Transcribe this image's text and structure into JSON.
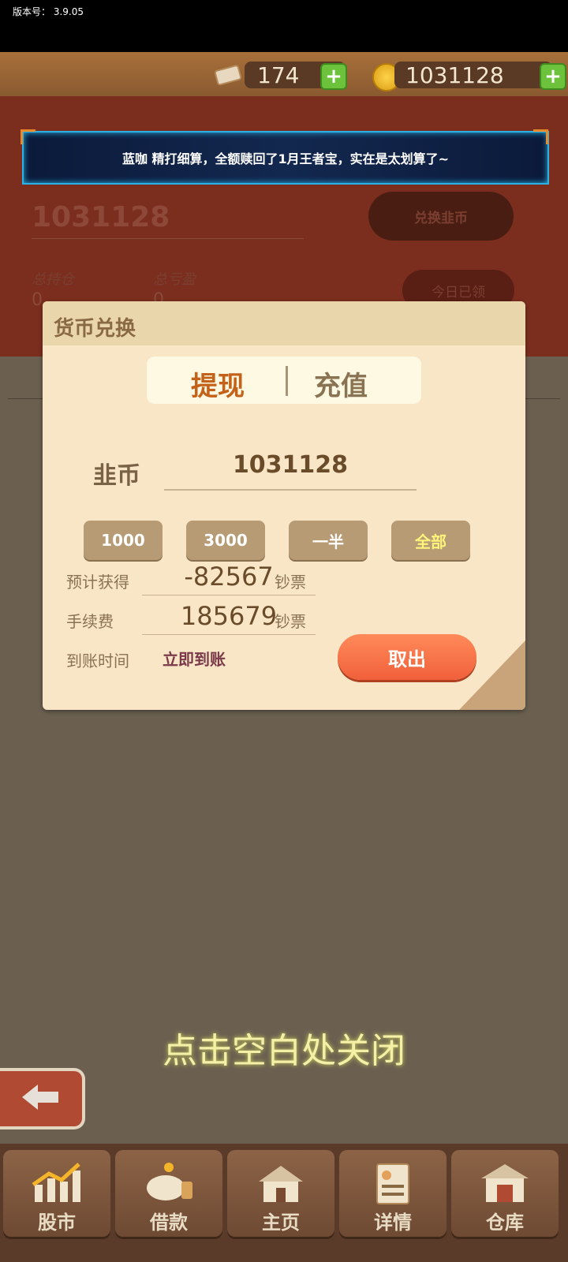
{
  "status": {
    "version_label": "版本号：",
    "version": "3.9.05"
  },
  "resources": {
    "tickets": "174",
    "coins": "1031128"
  },
  "banner": {
    "text": "蓝咖 精打细算，全额赎回了1月王者宝，实在是太划算了~"
  },
  "background": {
    "balance": "1031128",
    "exchange_button": "兑换韭币",
    "hold_label": "总持仓",
    "hold_value": "0",
    "pl_label": "总亏盈",
    "pl_value": "0",
    "today_button": "今日已领"
  },
  "dialog": {
    "title": "货币兑换",
    "tabs": [
      {
        "label": "提现",
        "active": true
      },
      {
        "label": "充值",
        "active": false
      }
    ],
    "currency_label": "韭币",
    "amount": "1031128",
    "quick_buttons": [
      "1000",
      "3000",
      "一半",
      "全部"
    ],
    "rows": [
      {
        "label": "预计获得",
        "value": "-82567",
        "unit": "钞票"
      },
      {
        "label": "手续费",
        "value": "185679",
        "unit": "钞票"
      }
    ],
    "arrival_label": "到账时间",
    "arrival_value": "立即到账",
    "withdraw_button": "取出"
  },
  "close_tip": "点击空白处关闭",
  "nav": [
    {
      "label": "股市",
      "icon": "stock-chart-icon"
    },
    {
      "label": "借款",
      "icon": "piggy-bank-icon"
    },
    {
      "label": "主页",
      "icon": "home-icon"
    },
    {
      "label": "详情",
      "icon": "profile-doc-icon"
    },
    {
      "label": "仓库",
      "icon": "warehouse-icon"
    }
  ],
  "colors": {
    "accent": "#f0603a",
    "active_tab": "#c4621a",
    "quick_all": "#fff47a"
  }
}
